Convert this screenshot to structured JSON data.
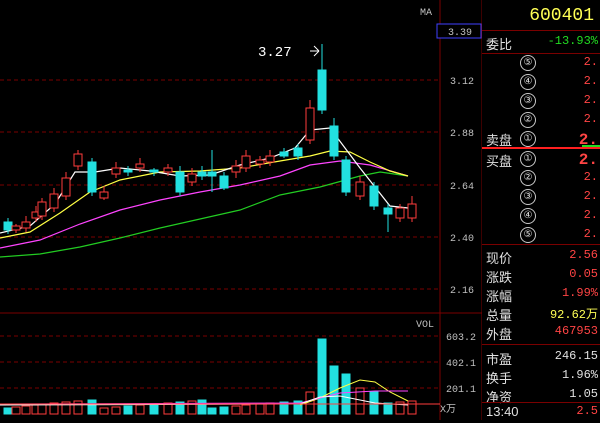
{
  "ma_label": "MA",
  "vol_label": "VOL",
  "price_box": "3.39",
  "peak_label": "3.27",
  "price_ticks": [
    "3.12",
    "2.88",
    "2.64",
    "2.40",
    "2.16"
  ],
  "vol_ticks": [
    "603.2",
    "402.1",
    "201.1"
  ],
  "vol_unit": "X万",
  "stock_code": "600401",
  "webi": {
    "label": "委比",
    "value": "-13.93%"
  },
  "sell_label": "卖盘",
  "buy_label": "买盘",
  "levels": [
    "⑤",
    "④",
    "③",
    "②",
    "①"
  ],
  "level_values": [
    "2.",
    "2.",
    "2.",
    "2.",
    "2."
  ],
  "buy_levels": [
    "①",
    "②",
    "③",
    "④",
    "⑤"
  ],
  "buy_values": [
    "2.",
    "2.",
    "2.",
    "2.",
    "2."
  ],
  "stats": [
    {
      "label": "现价",
      "value": "2.56",
      "color": "#ff4444"
    },
    {
      "label": "涨跌",
      "value": "0.05",
      "color": "#ff4444"
    },
    {
      "label": "涨幅",
      "value": "1.99%",
      "color": "#ff4444"
    },
    {
      "label": "总量",
      "value": "92.62万",
      "color": "#ffff55"
    },
    {
      "label": "外盘",
      "value": "467953",
      "color": "#ff4444"
    },
    {
      "label": "市盈",
      "value": "246.15",
      "color": "#e0e0e0"
    },
    {
      "label": "换手",
      "value": "1.96%",
      "color": "#e0e0e0"
    },
    {
      "label": "净资",
      "value": "1.05",
      "color": "#e0e0e0"
    }
  ],
  "time": "13:40",
  "time_price": "2.5",
  "colors": {
    "up": "#ff3c3c",
    "down": "#22e0e0",
    "ma5": "#ffffff",
    "ma10": "#ffff44",
    "ma20": "#ff44ff",
    "ma60": "#22cc22"
  }
}
